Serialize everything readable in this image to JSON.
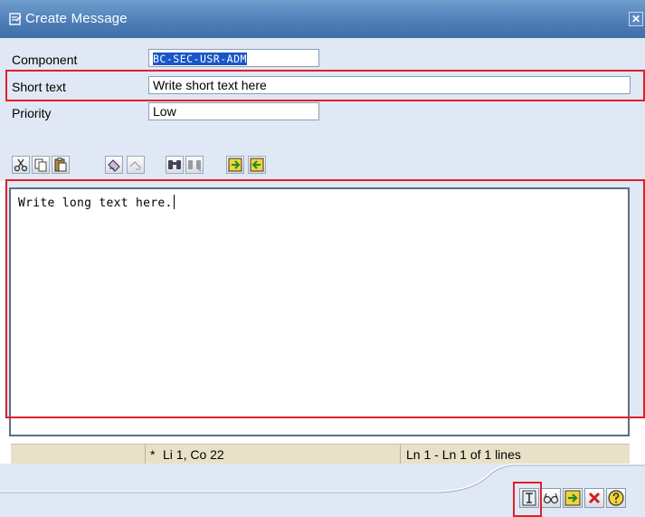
{
  "window": {
    "title": "Create Message",
    "close_glyph": "✕"
  },
  "form": {
    "component": {
      "label": "Component",
      "value": "BC-SEC-USR-ADM"
    },
    "short_text": {
      "label": "Short text",
      "value": "Write short text here"
    },
    "priority": {
      "label": "Priority",
      "value": "Low"
    }
  },
  "toolbar_icons": [
    "cut-icon",
    "copy-icon",
    "paste-icon",
    "undo-icon",
    "redo-icon",
    "find-icon",
    "find-next-icon",
    "upload-icon",
    "download-icon"
  ],
  "editor": {
    "text": "Write long text here."
  },
  "status": {
    "modified_marker": "*",
    "cursor_position": "Li 1, Co 22",
    "lines_info": "Ln 1 - Ln 1 of 1 lines"
  },
  "bottom_buttons": [
    "save-draft-icon",
    "glasses-icon",
    "transfer-icon",
    "cancel-icon",
    "help-icon"
  ],
  "colors": {
    "highlight": "#e0202a",
    "titlebar": "#4f7fb8",
    "selection": "#1856c8",
    "panel": "#dfe8f4",
    "statusbar": "#e8e1c7"
  }
}
